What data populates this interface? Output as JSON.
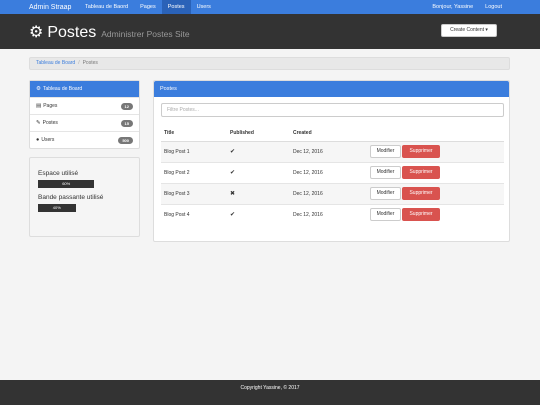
{
  "navbar": {
    "brand": "Admin Straap",
    "links": [
      "Tableau de Baord",
      "Pages",
      "Postes",
      "Users"
    ],
    "active_index": 2,
    "greeting": "Bonjour, Yassine",
    "logout": "Logout"
  },
  "header": {
    "title": "Postes",
    "subtitle": "Administrer Postes Site",
    "create_button": "Create Content ▾"
  },
  "breadcrumb": {
    "home": "Tableau de Board",
    "sep": "/",
    "current": "Postes"
  },
  "sidebar": {
    "items": [
      {
        "label": "Tableau de Board",
        "icon": "gear-icon",
        "glyph": "⚙",
        "badge": ""
      },
      {
        "label": "Pages",
        "icon": "list-icon",
        "glyph": "▤",
        "badge": "12"
      },
      {
        "label": "Postes",
        "icon": "pencil-icon",
        "glyph": "✎",
        "badge": "15"
      },
      {
        "label": "Users",
        "icon": "user-icon",
        "glyph": "👤",
        "badge": "500"
      }
    ]
  },
  "usage": {
    "disk_label": "Espace utilisé",
    "disk_text": "60%",
    "disk_fraction": 0.6,
    "bandwidth_label": "Bande passante utilisé",
    "bandwidth_text": "40%",
    "bandwidth_fraction": 0.4
  },
  "panel": {
    "title": "Postes",
    "filter_placeholder": "Filtre Postes...",
    "columns": [
      "Title",
      "Published",
      "Created",
      ""
    ],
    "rows": [
      {
        "title": "Blog Post 1",
        "published": "✔",
        "created": "Dec 12, 2016"
      },
      {
        "title": "Blog Post 2",
        "published": "✔",
        "created": "Dec 12, 2016"
      },
      {
        "title": "Blog Post 3",
        "published": "✖",
        "created": "Dec 12, 2016"
      },
      {
        "title": "Blog Post 4",
        "published": "✔",
        "created": "Dec 12, 2016"
      }
    ],
    "edit_label": "Modifier",
    "delete_label": "Supprimer"
  },
  "footer": {
    "text": "Copyright Yassine, © 2017"
  },
  "colors": {
    "primary": "#3b7ddd",
    "dark": "#333333",
    "danger": "#d9534f"
  }
}
